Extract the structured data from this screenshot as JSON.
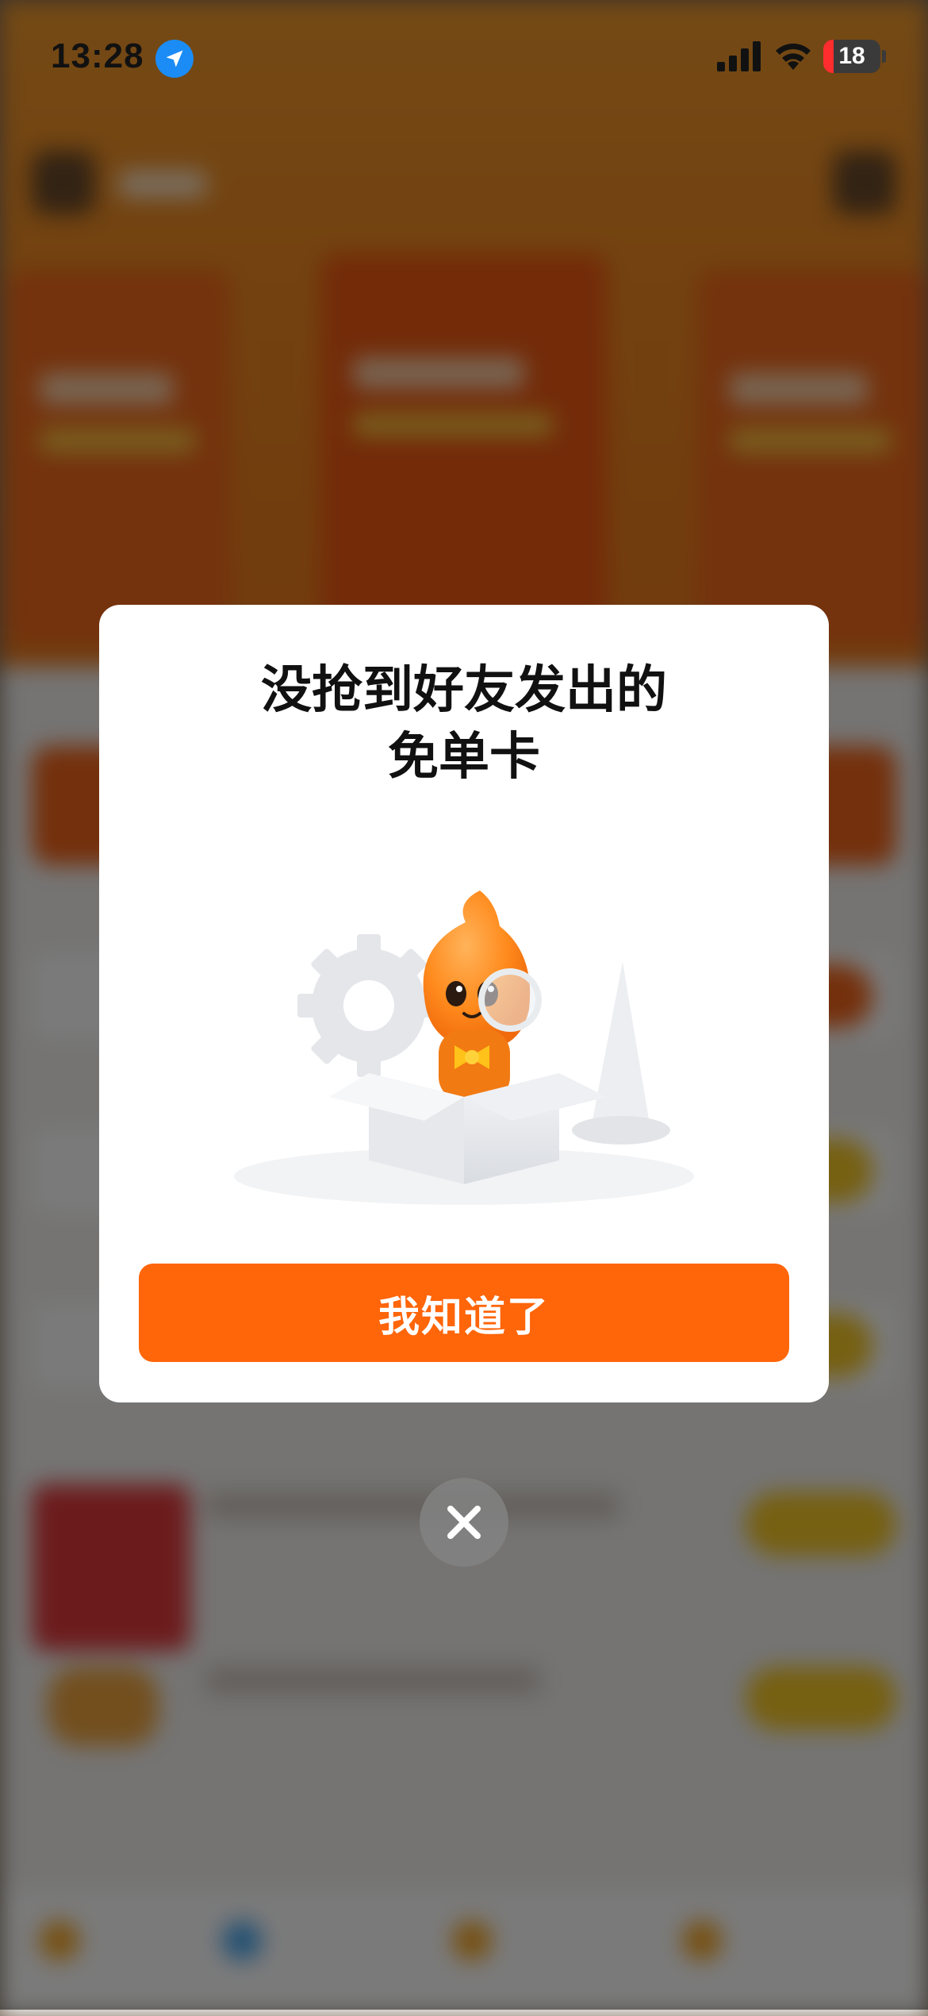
{
  "status_bar": {
    "time": "13:28",
    "battery": "18",
    "battery_level_percent": 18,
    "icons": [
      "location-arrow-icon",
      "cellular-signal-icon",
      "wifi-icon",
      "battery-icon"
    ]
  },
  "modal": {
    "title_line1": "没抢到好友发出的",
    "title_line2": "免单卡",
    "illustration": "mascot-in-box-illustration",
    "confirm_label": "我知道了"
  },
  "close_icon": "close-icon",
  "colors": {
    "accent": "#ff6509",
    "overlay": "rgba(0,0,0,0.52)",
    "location_blue": "#1b8cf5",
    "battery_low_red": "#ff2d2d"
  }
}
